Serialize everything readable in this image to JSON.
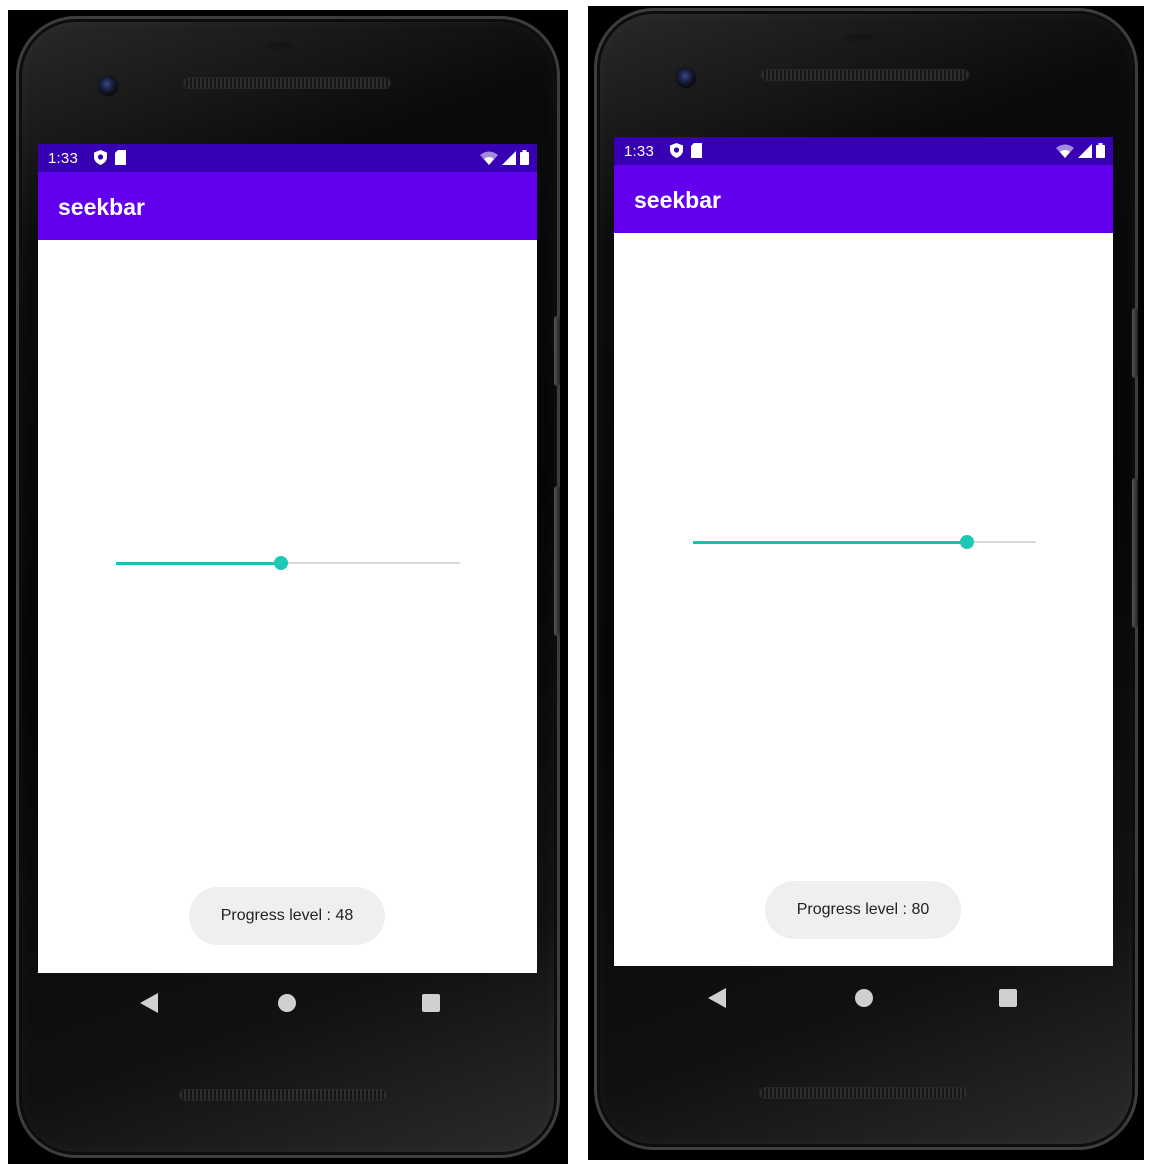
{
  "phones": [
    {
      "status_time": "1:33",
      "app_title": "seekbar",
      "progress": 48,
      "toast_text": "Progress level : 48"
    },
    {
      "status_time": "1:33",
      "app_title": "seekbar",
      "progress": 80,
      "toast_text": "Progress level : 80"
    }
  ],
  "seekbar_max": 100,
  "colors": {
    "status_bar": "#3700b3",
    "app_bar": "#6200ee",
    "seek_progress": "#1fbfb0",
    "seek_thumb": "#1fc8b4",
    "seek_track": "#d9d9d9",
    "toast_bg": "#efefef"
  },
  "icons": {
    "status_left": [
      "shield-icon",
      "sd-card-icon"
    ],
    "status_right": [
      "wifi-icon",
      "signal-icon",
      "battery-icon"
    ],
    "nav": [
      "back-icon",
      "home-icon",
      "recents-icon"
    ]
  }
}
